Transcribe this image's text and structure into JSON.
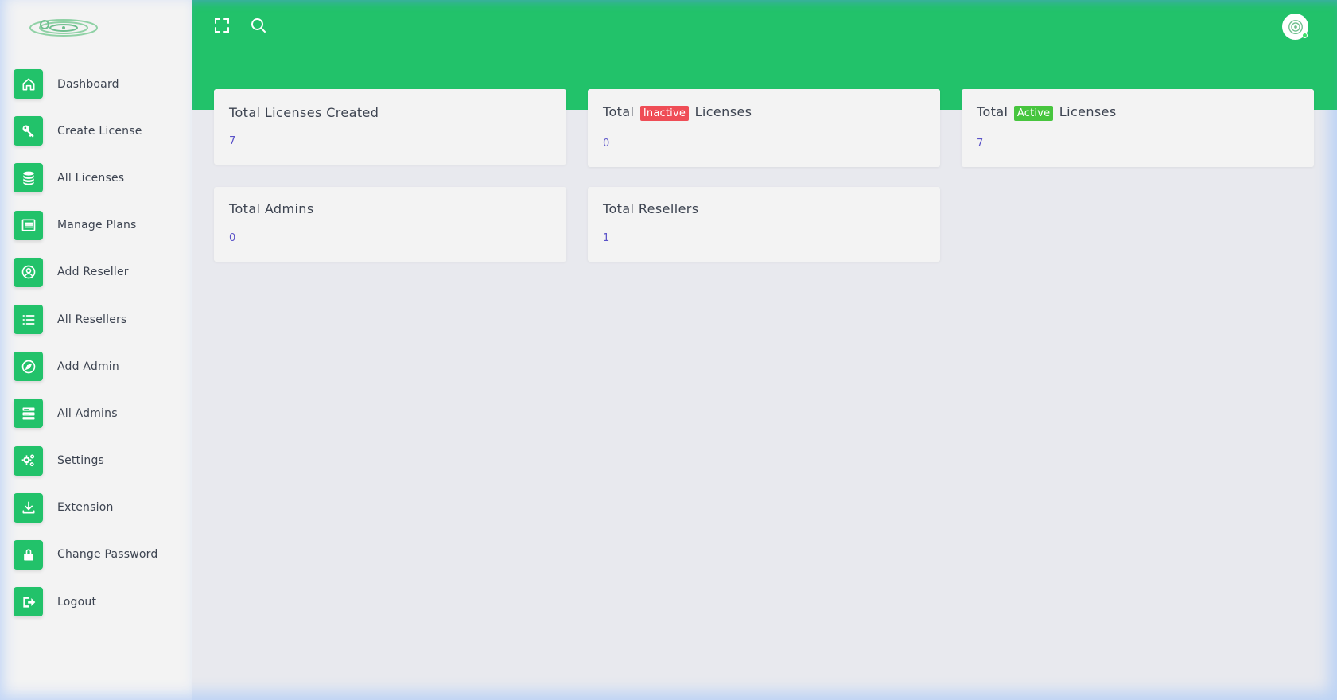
{
  "sidebar": {
    "items": [
      {
        "label": "Dashboard",
        "icon": "home-icon"
      },
      {
        "label": "Create License",
        "icon": "key-icon"
      },
      {
        "label": "All Licenses",
        "icon": "database-icon"
      },
      {
        "label": "Manage Plans",
        "icon": "list-alt-icon"
      },
      {
        "label": "Add Reseller",
        "icon": "user-circle-icon"
      },
      {
        "label": "All Resellers",
        "icon": "list-icon"
      },
      {
        "label": "Add Admin",
        "icon": "compass-icon"
      },
      {
        "label": "All Admins",
        "icon": "server-icon"
      },
      {
        "label": "Settings",
        "icon": "gears-icon"
      },
      {
        "label": "Extension",
        "icon": "download-icon"
      },
      {
        "label": "Change Password",
        "icon": "lock-icon"
      },
      {
        "label": "Logout",
        "icon": "sign-out-icon"
      }
    ]
  },
  "header": {
    "fullscreen_icon": "fullscreen-icon",
    "search_icon": "search-icon"
  },
  "cards": {
    "total_created": {
      "title": "Total Licenses Created",
      "value": "7"
    },
    "total_inactive": {
      "prefix": "Total",
      "badge": "Inactive",
      "suffix": "Licenses",
      "value": "0"
    },
    "total_active": {
      "prefix": "Total",
      "badge": "Active",
      "suffix": "Licenses",
      "value": "7"
    },
    "total_admins": {
      "title": "Total Admins",
      "value": "0"
    },
    "total_resellers": {
      "title": "Total Resellers",
      "value": "1"
    }
  },
  "colors": {
    "accent": "#22c26a",
    "inactive": "#ef4d56",
    "active": "#47c53e",
    "value_text": "#5a52c8"
  }
}
